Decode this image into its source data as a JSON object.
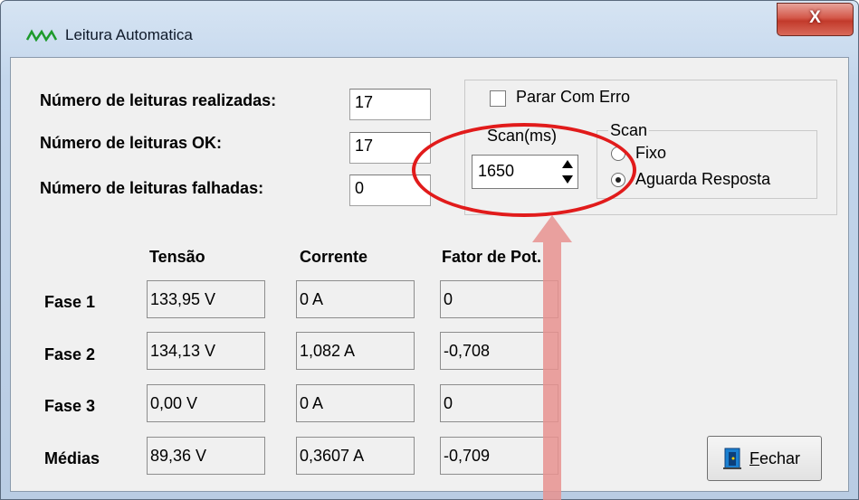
{
  "window": {
    "title": "Leitura Automatica",
    "close_label": "X"
  },
  "counts": {
    "realizadas_label": "Número de leituras realizadas:",
    "realizadas_value": "17",
    "ok_label": "Número de leituras OK:",
    "ok_value": "17",
    "falhadas_label": "Número de leituras falhadas:",
    "falhadas_value": "0"
  },
  "options": {
    "parar_label": "Parar Com Erro",
    "parar_checked": false,
    "scan_ms_label": "Scan(ms)",
    "scan_ms_value": "1650",
    "scan_group_label": "Scan",
    "fixo_label": "Fixo",
    "aguarda_label": "Aguarda Resposta",
    "selected_mode": "Aguarda Resposta"
  },
  "table": {
    "headers": [
      "Tensão",
      "Corrente",
      "Fator de Pot."
    ],
    "rows": [
      {
        "label": "Fase 1",
        "tensao": "133,95 V",
        "corrente": "0 A",
        "fator": "0"
      },
      {
        "label": "Fase 2",
        "tensao": "134,13 V",
        "corrente": "1,082 A",
        "fator": "-0,708"
      },
      {
        "label": "Fase 3",
        "tensao": "0,00 V",
        "corrente": "0 A",
        "fator": "0"
      },
      {
        "label": "Médias",
        "tensao": "89,36 V",
        "corrente": "0,3607 A",
        "fator": "-0,709"
      }
    ]
  },
  "buttons": {
    "fechar_label": "Fechar"
  },
  "icons": {
    "app": "waveform-icon",
    "close": "close-icon",
    "fechar": "exit-door-icon"
  },
  "colors": {
    "annotation_red": "#e11b1b",
    "annotation_arrow": "#e8928f",
    "close_red": "#c23a2b"
  }
}
